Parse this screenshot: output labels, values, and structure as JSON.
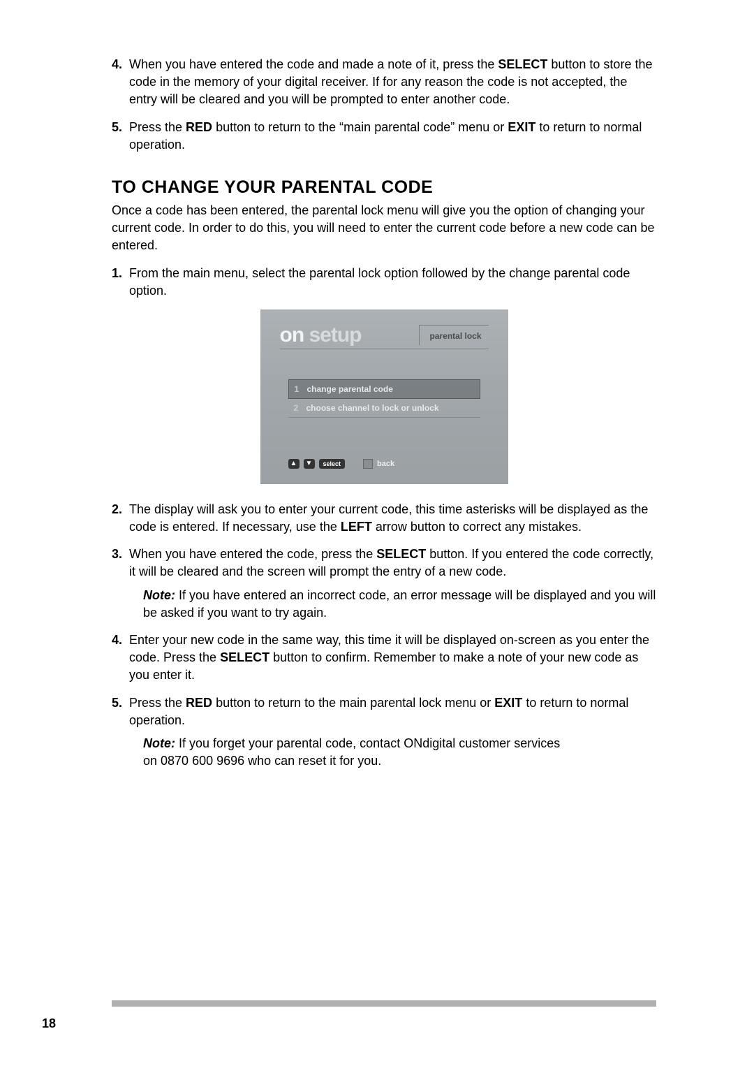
{
  "continued": {
    "items": [
      {
        "n": "4.",
        "segments": [
          {
            "t": "When you have entered the code and made a note of it, press the "
          },
          {
            "t": "SELECT",
            "b": true
          },
          {
            "t": " button to store the code in the memory of your digital receiver. If for any reason the code is not accepted, the entry will be cleared and you will be prompted to enter another code."
          }
        ]
      },
      {
        "n": "5.",
        "segments": [
          {
            "t": "Press the "
          },
          {
            "t": "RED",
            "b": true
          },
          {
            "t": " button to return to the “main parental code” menu or "
          },
          {
            "t": "EXIT",
            "b": true
          },
          {
            "t": " to return to normal operation."
          }
        ]
      }
    ]
  },
  "section": {
    "heading": "TO CHANGE YOUR PARENTAL CODE",
    "intro": "Once a code has been entered, the parental lock menu will give you the option of changing your current code. In order to do this, you will need to enter the current code before a new code can be entered.",
    "items_a": [
      {
        "n": "1.",
        "segments": [
          {
            "t": "From the main menu, select the parental lock option followed by the change parental code option."
          }
        ]
      }
    ],
    "items_b": [
      {
        "n": "2.",
        "segments": [
          {
            "t": "The display will ask you to enter your current code, this time asterisks will be displayed as the code is entered. If necessary, use the "
          },
          {
            "t": "LEFT",
            "b": true
          },
          {
            "t": " arrow button to correct any mistakes."
          }
        ]
      },
      {
        "n": "3.",
        "segments": [
          {
            "t": "When you have entered the code, press the "
          },
          {
            "t": "SELECT",
            "b": true
          },
          {
            "t": " button. If you entered the code correctly, it will be cleared and the screen will prompt the entry of a new code."
          }
        ]
      }
    ],
    "note_a": {
      "segments": [
        {
          "t": "Note:",
          "b": true,
          "i": true
        },
        {
          "t": " If you have entered an incorrect code, an error message will be displayed and you will be asked if you want to try again."
        }
      ]
    },
    "items_c": [
      {
        "n": "4.",
        "segments": [
          {
            "t": "Enter your new code in the same way, this time it will be displayed on-screen as you enter the code. Press the "
          },
          {
            "t": "SELECT",
            "b": true
          },
          {
            "t": " button to confirm. Remember to make a note of your new code as you enter it."
          }
        ]
      },
      {
        "n": "5.",
        "segments": [
          {
            "t": "Press the "
          },
          {
            "t": "RED",
            "b": true
          },
          {
            "t": " button to return to the main parental lock menu or "
          },
          {
            "t": "EXIT",
            "b": true
          },
          {
            "t": " to return to normal operation."
          }
        ]
      }
    ],
    "note_b": {
      "segments": [
        {
          "t": "Note:",
          "b": true,
          "i": true
        },
        {
          "t": " If you forget your parental code, contact ONdigital customer services on 0870 600 9696 who can reset it for you."
        }
      ]
    }
  },
  "screenshot": {
    "logo_on": "on",
    "logo_setup": " setup",
    "title": "parental lock",
    "menu": [
      {
        "n": "1",
        "label": "change parental code",
        "highlight": true
      },
      {
        "n": "2",
        "label": "choose channel to lock or unlock",
        "highlight": false
      }
    ],
    "footer": {
      "select": "select",
      "back": "back"
    }
  },
  "page_number": "18"
}
